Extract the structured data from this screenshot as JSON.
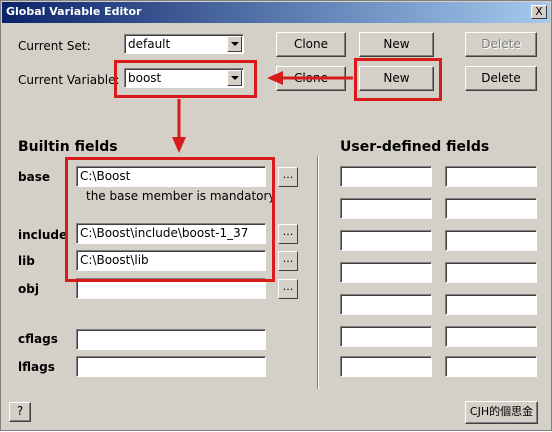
{
  "window": {
    "title": "Global Variable Editor",
    "close_glyph": "X"
  },
  "top": {
    "current_set_label": "Current Set:",
    "current_set_value": "default",
    "current_variable_label": "Current Variable:",
    "current_variable_value": "boost",
    "set_clone": "Clone",
    "set_new": "New",
    "set_delete": "Delete",
    "var_clone": "Clone",
    "var_new": "New",
    "var_delete": "Delete"
  },
  "builtin": {
    "title": "Builtin fields",
    "base_label": "base",
    "base_value": "C:\\Boost",
    "base_note": "the base member is mandatory",
    "include_label": "include",
    "include_value": "C:\\Boost\\include\\boost-1_37",
    "lib_label": "lib",
    "lib_value": "C:\\Boost\\lib",
    "obj_label": "obj",
    "obj_value": "",
    "cflags_label": "cflags",
    "cflags_value": "",
    "lflags_label": "lflags",
    "lflags_value": "",
    "browse_label": "..."
  },
  "user_defined": {
    "title": "User-defined fields",
    "rows": [
      {
        "left": "",
        "right": ""
      },
      {
        "left": "",
        "right": ""
      },
      {
        "left": "",
        "right": ""
      },
      {
        "left": "",
        "right": ""
      },
      {
        "left": "",
        "right": ""
      },
      {
        "left": "",
        "right": ""
      },
      {
        "left": "",
        "right": ""
      }
    ]
  },
  "bottom": {
    "help_label": "?",
    "watermark": "CJH的個思金"
  },
  "colors": {
    "annotation": "#d71b1b",
    "face": "#d4d0c8"
  }
}
